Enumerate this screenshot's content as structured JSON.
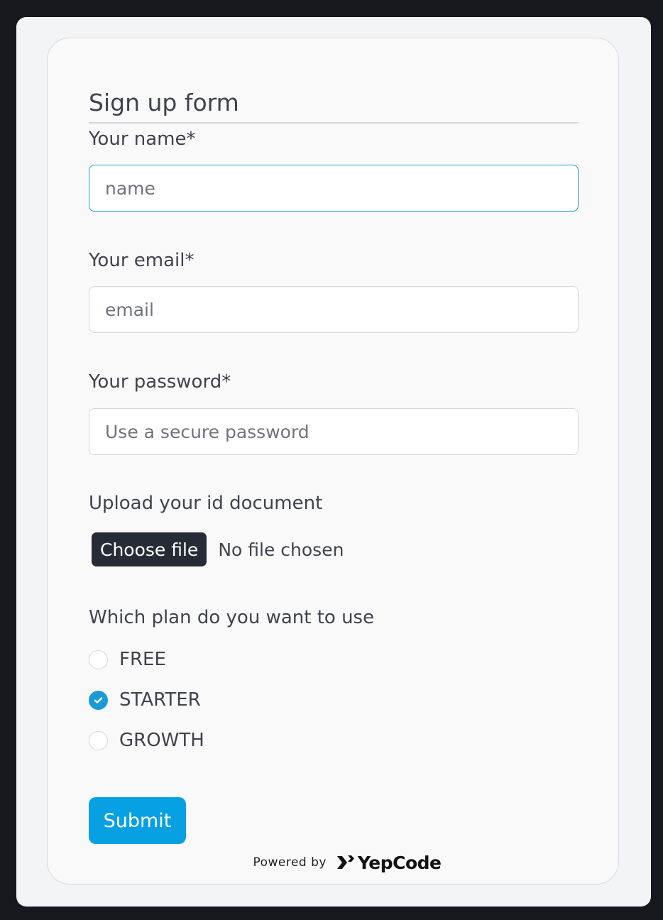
{
  "form": {
    "title": "Sign up form",
    "name": {
      "label": "Your name*",
      "placeholder": "name",
      "value": ""
    },
    "email": {
      "label": "Your email*",
      "placeholder": "email",
      "value": ""
    },
    "password": {
      "label": "Your password*",
      "placeholder": "Use a secure password",
      "value": ""
    },
    "upload": {
      "label": "Upload your id document",
      "button_label": "Choose file",
      "status": "No file chosen"
    },
    "plan": {
      "label": "Which plan do you want to use",
      "options": [
        {
          "label": "FREE",
          "checked": false
        },
        {
          "label": "STARTER",
          "checked": true
        },
        {
          "label": "GROWTH",
          "checked": false
        }
      ],
      "selected": "STARTER"
    },
    "submit_label": "Submit"
  },
  "footer": {
    "powered_by": "Powered by",
    "brand": "YepCode"
  },
  "colors": {
    "accent": "#07a0e3",
    "focus_border": "#1a9bd7",
    "file_button_bg": "#262b36",
    "page_bg": "#16181d",
    "panel_bg": "#f3f4f6",
    "card_bg": "#f9f9fa",
    "text": "#3f434d"
  },
  "icons": {
    "radio_check": "check-icon",
    "brand_mark": "yepcode-logo-icon"
  }
}
